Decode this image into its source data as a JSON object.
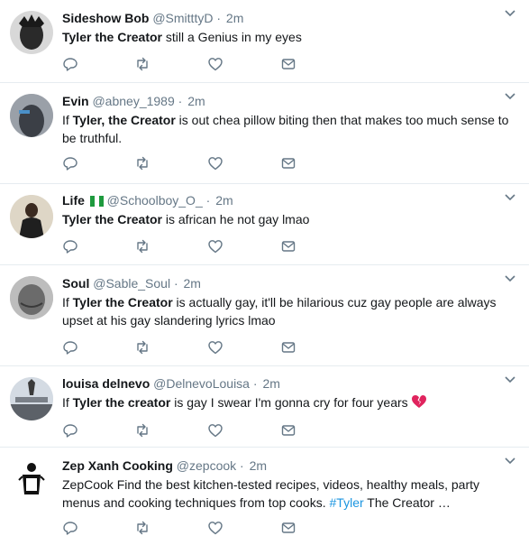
{
  "tweets": [
    {
      "name": "Sideshow Bob",
      "handle": "@SmitttyD",
      "dot": "·",
      "time": "2m",
      "bold1": "Tyler the Creator",
      "text1": " still a Genius in my eyes",
      "avatar_color": "#2a2a2a"
    },
    {
      "name": "Evin",
      "handle": "@abney_1989",
      "dot": "·",
      "time": "2m",
      "text0": "If ",
      "bold1": "Tyler, the Creator",
      "text1": " is out chea pillow biting then that makes too much sense to be truthful.",
      "avatar_color": "#3b3f46"
    },
    {
      "name": "Life",
      "handle": "@Schoolboy_O_",
      "dot": "·",
      "time": "2m",
      "bold1": "Tyler the Creator",
      "text1": " is african he not gay lmao",
      "avatar_color": "#5a4a3a"
    },
    {
      "name": "Soul",
      "handle": "@Sable_Soul",
      "dot": "·",
      "time": "2m",
      "text0": "If ",
      "bold1": "Tyler the Creator",
      "text1": " is actually gay, it'll be hilarious cuz gay people are always upset at his gay slandering lyrics lmao",
      "avatar_color": "#6b6b6b"
    },
    {
      "name": "louisa delnevo",
      "handle": "@DelnevoLouisa",
      "dot": "·",
      "time": "2m",
      "text0": "If ",
      "bold1": "Tyler the creator",
      "text1": " is gay I swear I'm gonna cry for four years",
      "avatar_color": "#8a8f96"
    },
    {
      "name": "Zep Xanh Cooking",
      "handle": "@zepcook",
      "dot": "·",
      "time": "2m",
      "text1": "ZepCook Find the best kitchen-tested recipes, videos, healthy meals, party menus and cooking techniques from top cooks. ",
      "hashtag": "#Tyler",
      "text2": " The Creator …",
      "avatar_color": "#ffffff"
    }
  ],
  "icons": [
    "reply-icon",
    "retweet-icon",
    "like-icon",
    "direct-message-icon",
    "chevron-down-icon"
  ],
  "colors": {
    "icon": "#657786",
    "link": "#1b95e0",
    "border": "#e6ecf0"
  }
}
